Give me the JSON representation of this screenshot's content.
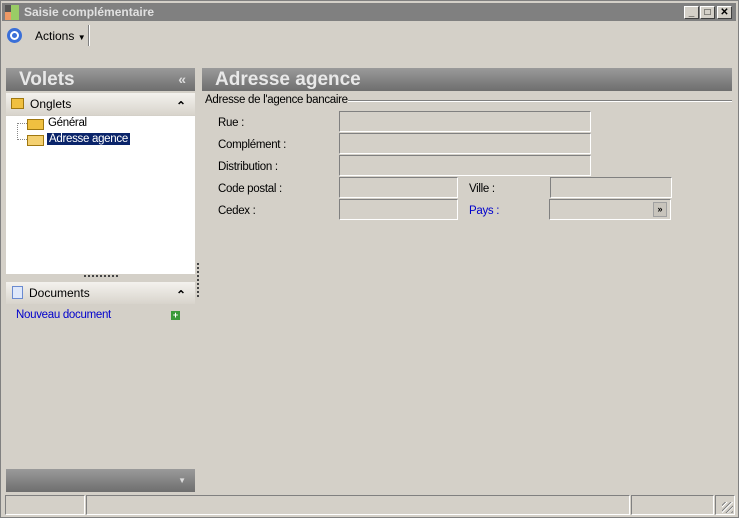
{
  "window": {
    "title": "Saisie complémentaire",
    "minimize": "_",
    "maximize": "□",
    "close": "✕"
  },
  "toolbar": {
    "actions_label": "Actions"
  },
  "sidebar": {
    "title": "Volets",
    "collapse": "«",
    "onglets": {
      "label": "Onglets",
      "toggle": "⌃",
      "items": [
        {
          "label": "Général"
        },
        {
          "label": "Adresse agence",
          "selected": true
        }
      ]
    },
    "documents": {
      "label": "Documents",
      "toggle": "⌃",
      "new_document": "Nouveau document"
    }
  },
  "main": {
    "title": "Adresse agence",
    "group_label": "Adresse de l'agence bancaire",
    "fields": {
      "rue": "Rue :",
      "complement": "Complément :",
      "distribution": "Distribution :",
      "code_postal": "Code postal :",
      "ville": "Ville :",
      "cedex": "Cedex :",
      "pays": "Pays :"
    }
  },
  "colors": {
    "link": "#0000cc",
    "header": "#808080",
    "selection": "#0a246a"
  }
}
